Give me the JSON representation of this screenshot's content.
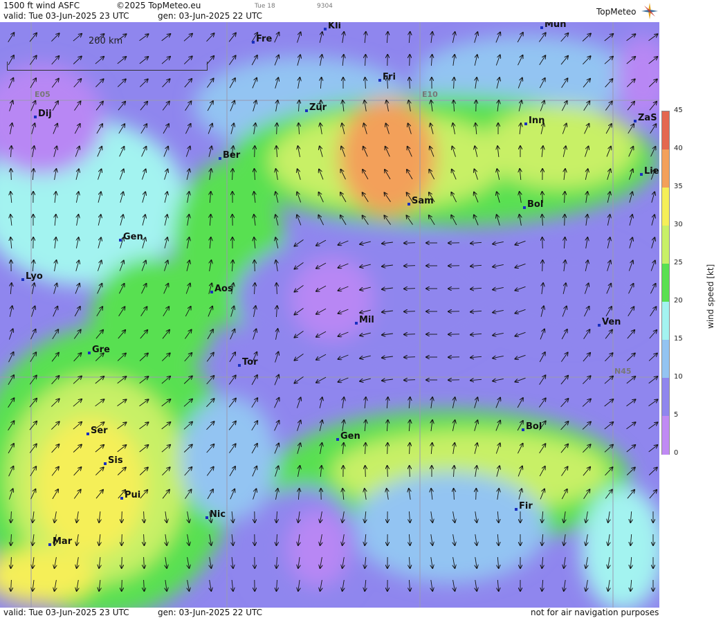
{
  "header": {
    "product": "1500 ft wind ASFC",
    "copyright": "©2025 TopMeteo.eu",
    "day_tag": "Tue 18",
    "code": "9304",
    "valid": "valid:  Tue  03-Jun-2025  23 UTC",
    "gen": "gen: 03-Jun-2025 22 UTC",
    "logo": "TopMeteo"
  },
  "map": {
    "scale_label": "200 km",
    "coords": [
      {
        "label": "E05"
      },
      {
        "label": "E10"
      },
      {
        "label": "N45"
      }
    ],
    "cities": [
      {
        "label": "Kli"
      },
      {
        "label": "Mun"
      },
      {
        "label": "Fre"
      },
      {
        "label": "Fri"
      },
      {
        "label": "Dij"
      },
      {
        "label": "Zür"
      },
      {
        "label": "Inn"
      },
      {
        "label": "ZaS"
      },
      {
        "label": "Ber"
      },
      {
        "label": "Lie"
      },
      {
        "label": "Sam"
      },
      {
        "label": "Bol"
      },
      {
        "label": "Gen"
      },
      {
        "label": "Lyo"
      },
      {
        "label": "Aos"
      },
      {
        "label": "Mil"
      },
      {
        "label": "Ven"
      },
      {
        "label": "Gre"
      },
      {
        "label": "Tor"
      },
      {
        "label": "Ser"
      },
      {
        "label": "Gen"
      },
      {
        "label": "Bol"
      },
      {
        "label": "Sis"
      },
      {
        "label": "Pui"
      },
      {
        "label": "Nic"
      },
      {
        "label": "Fir"
      },
      {
        "label": "Mar"
      }
    ]
  },
  "footer": {
    "valid": "valid:  Tue  03-Jun-2025  23 UTC",
    "gen": "gen: 03-Jun-2025 22 UTC",
    "disclaimer": "not for air navigation purposes"
  },
  "legend": {
    "title": "wind speed  [kt]",
    "ticks": [
      "45",
      "40",
      "35",
      "30",
      "25",
      "20",
      "15",
      "10",
      "5",
      "0"
    ],
    "colors": [
      "#e4684f",
      "#f3a05a",
      "#f5ef58",
      "#c8f066",
      "#59e051",
      "#a3f3f0",
      "#93c4f2",
      "#8f86ee",
      "#c08af4"
    ]
  }
}
